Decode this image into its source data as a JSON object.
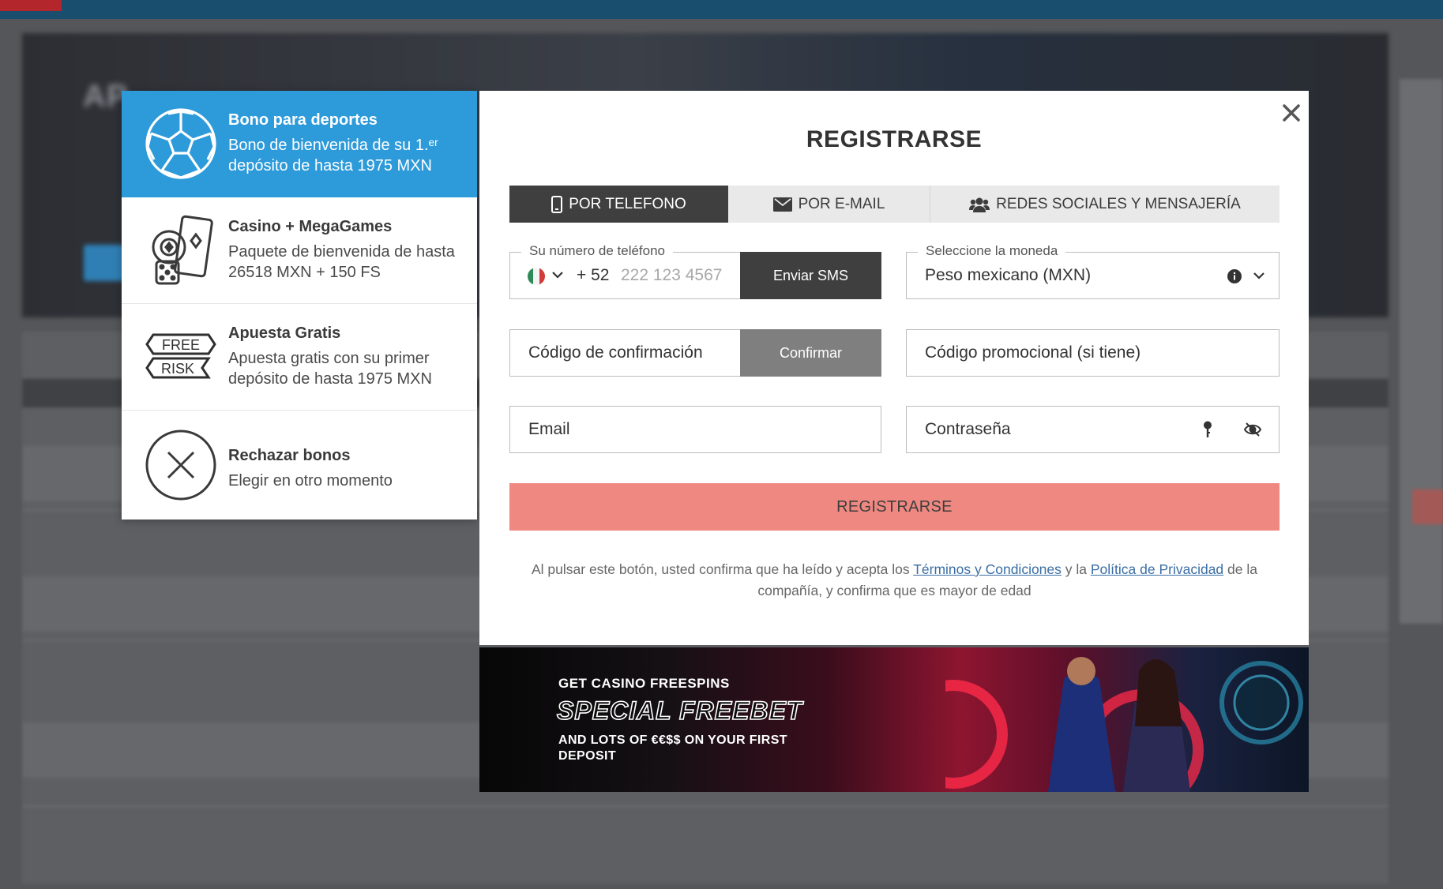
{
  "bonus_panel": {
    "items": [
      {
        "icon": "soccer-ball-icon",
        "title": "Bono para deportes",
        "desc": "Bono de bienvenida de su 1.ᵉʳ depósito de hasta 1975 MXN"
      },
      {
        "icon": "casino-chips-icon",
        "title": "Casino + MegaGames",
        "desc": "Paquete de bienvenida de hasta 26518 MXN + 150 FS"
      },
      {
        "icon": "free-risk-icon",
        "title": "Apuesta Gratis",
        "desc": "Apuesta gratis con su primer depósito de hasta 1975 MXN",
        "icon_text_top": "FREE",
        "icon_text_bottom": "RISK"
      },
      {
        "icon": "reject-x-icon",
        "title": "Rechazar bonos",
        "desc": "Elegir en otro momento"
      }
    ]
  },
  "modal": {
    "title": "REGISTRARSE",
    "close_icon": "close-icon",
    "tabs": [
      {
        "label": "POR TELEFONO",
        "icon": "phone-icon"
      },
      {
        "label": "POR E-MAIL",
        "icon": "envelope-icon"
      },
      {
        "label": "REDES SOCIALES Y MENSAJERÍA",
        "icon": "users-icon"
      }
    ],
    "phone": {
      "legend": "Su número de teléfono",
      "country_code": "+ 52",
      "placeholder": "222 123 4567",
      "sms_button": "Enviar SMS"
    },
    "currency": {
      "legend": "Seleccione la moneda",
      "value": "Peso mexicano (MXN)"
    },
    "confirmation": {
      "placeholder": "Código de confirmación",
      "button": "Confirmar"
    },
    "promo_code": {
      "placeholder": "Código promocional (si tiene)"
    },
    "email": {
      "placeholder": "Email"
    },
    "password": {
      "placeholder": "Contraseña"
    },
    "register_button": "REGISTRARSE",
    "legal": {
      "text1": "Al pulsar este botón, usted confirma que ha leído y acepta los ",
      "link1": "Términos y Condiciones",
      "text2": " y la ",
      "link2": "Política de Privacidad",
      "text3": " de la compañía, y confirma que es mayor de edad"
    }
  },
  "promo_banner": {
    "line1": "GET CASINO FREESPINS",
    "line2": "SPECIAL FREEBET",
    "line3": "AND LOTS OF €€$$ ON YOUR FIRST DEPOSIT"
  },
  "colors": {
    "accent_blue": "#2d9ad9",
    "tab_active": "#3f3f3f",
    "register_button": "#ee8880",
    "link": "#3a6ea5"
  }
}
